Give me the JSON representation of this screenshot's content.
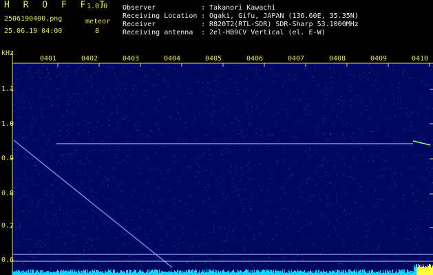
{
  "header": {
    "app_name": "H R O F F T",
    "version": "1.0.0",
    "filename": "2506190400.png",
    "datetime": "25.06.19 04:00",
    "meteor_label": "meteor",
    "meteor_count": "8",
    "info": [
      {
        "key": "Observer",
        "value": ": Takanori Kawachi"
      },
      {
        "key": "Receiving Location",
        "value": ": Ogaki, Gifu, JAPAN (136.60E, 35.35N)"
      },
      {
        "key": "Receiver",
        "value": ": R820T2(RTL-SDR) SDR-Sharp 53.1000MHz"
      },
      {
        "key": "Receiving antenna",
        "value": ": 2el-HB9CV Vertical (el. E-W)"
      }
    ]
  },
  "spectrogram": {
    "y_unit": "kHz",
    "time_labels": [
      "0401",
      "0402",
      "0403",
      "0404",
      "0405",
      "0406",
      "0407",
      "0408",
      "0409",
      "0410"
    ],
    "freq_labels": [
      "1.1",
      "1.0",
      "0.9",
      "0.8",
      "0.7",
      "0.6"
    ],
    "background_color": "#000860",
    "signal_color": "#6aa0ff",
    "baseline_color": "#00d8ff"
  }
}
